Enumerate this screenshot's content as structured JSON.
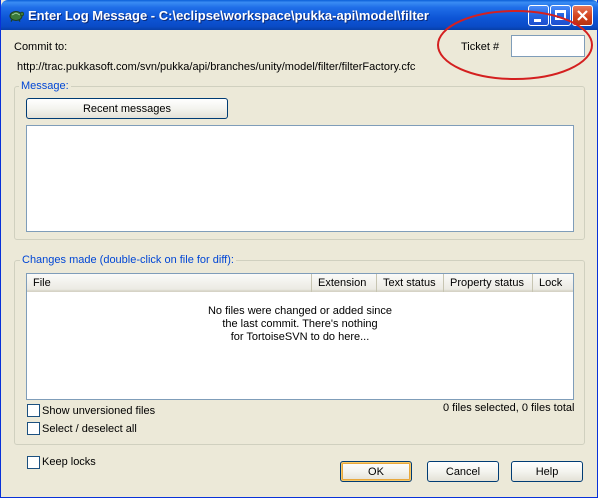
{
  "window": {
    "title": "Enter Log Message - C:\\eclipse\\workspace\\pukka-api\\model\\filter"
  },
  "commit": {
    "label": "Commit to:",
    "url": "http://trac.pukkasoft.com/svn/pukka/api/branches/unity/model/filter/filterFactory.cfc",
    "ticket_label": "Ticket #",
    "ticket_value": ""
  },
  "message": {
    "group_title": "Message:",
    "recent_button": "Recent messages",
    "value": ""
  },
  "changes": {
    "group_title": "Changes made (double-click on file for diff):",
    "columns": [
      "File",
      "Extension",
      "Text status",
      "Property status",
      "Lock"
    ],
    "empty_lines": [
      "No files were changed or added since",
      "the last commit. There's nothing",
      "for TortoiseSVN to do here..."
    ],
    "show_unversioned": "Show unversioned files",
    "select_all": "Select / deselect all",
    "summary": "0 files selected, 0 files total"
  },
  "footer": {
    "keep_locks": "Keep locks",
    "ok": "OK",
    "cancel": "Cancel",
    "help": "Help"
  },
  "colors": {
    "titlebar": "#0a55d6",
    "group_title": "#0046d5",
    "annotation_ellipse": "#d42020"
  },
  "icons": {
    "app": "tortoisesvn-icon",
    "minimize": "minimize-icon",
    "maximize": "maximize-icon",
    "close": "close-icon"
  }
}
